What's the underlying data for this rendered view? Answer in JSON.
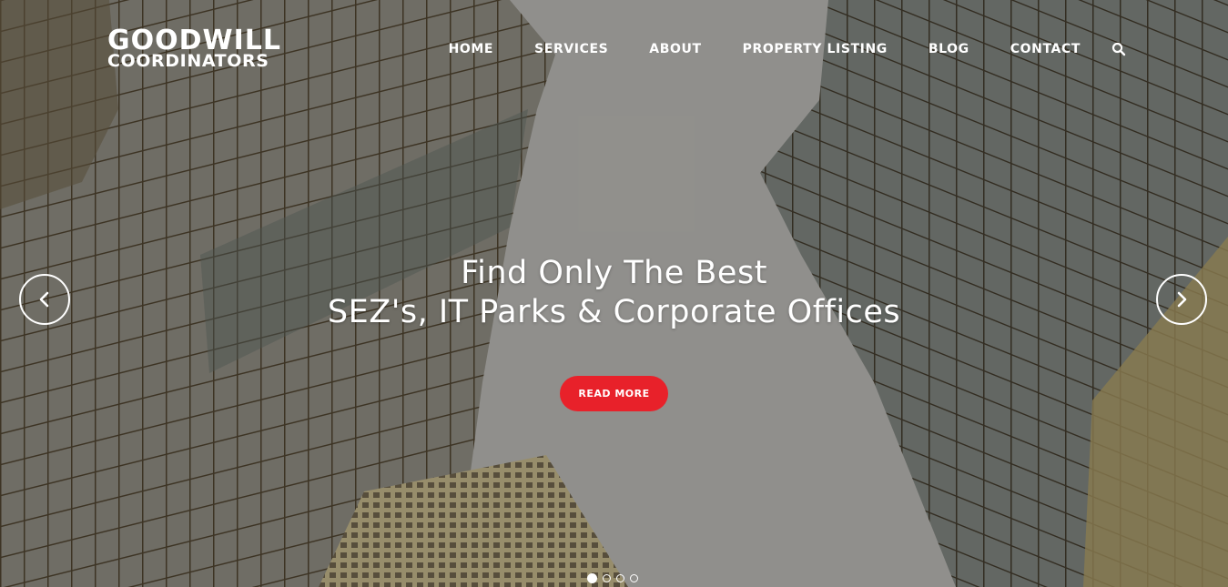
{
  "brand": {
    "line1": "GOODWILL",
    "line2": "COORDINATORS"
  },
  "nav": {
    "items": [
      "HOME",
      "SERVICES",
      "ABOUT",
      "PROPERTY LISTING",
      "BLOG",
      "CONTACT"
    ],
    "search_icon": "search-icon"
  },
  "hero": {
    "headline_line1": "Find Only The Best",
    "headline_line2": "SEZ's, IT Parks & Corporate Offices",
    "cta_label": "READ MORE",
    "prev_icon": "chevron-left-icon",
    "next_icon": "chevron-right-icon",
    "slides_total": 4,
    "active_slide": 1
  },
  "colors": {
    "accent": "#e8212a",
    "text": "#ffffff"
  }
}
